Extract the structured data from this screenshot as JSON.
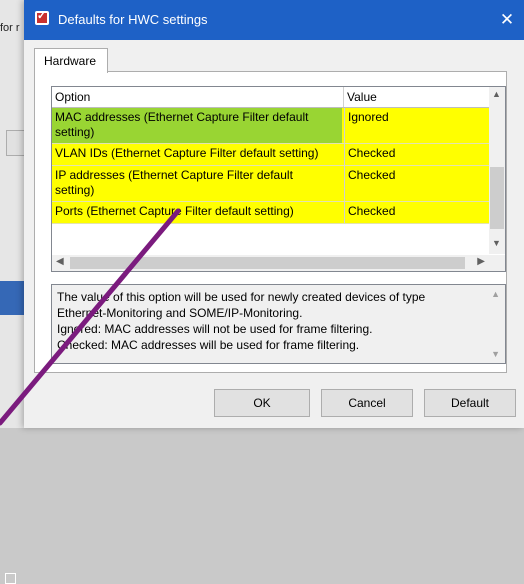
{
  "background": {
    "partial_text": "for r"
  },
  "dialog": {
    "title": "Defaults for HWC settings",
    "close_glyph": "✕",
    "tab_label": "Hardware",
    "columns": {
      "option": "Option",
      "value": "Value"
    },
    "rows": [
      {
        "option_lines": [
          "MAC addresses (Ethernet Capture Filter default",
          "setting)"
        ],
        "value": "Ignored",
        "selected": true
      },
      {
        "option_lines": [
          "VLAN IDs (Ethernet Capture Filter default setting)"
        ],
        "value": "Checked",
        "selected": false
      },
      {
        "option_lines": [
          "IP addresses (Ethernet Capture Filter default",
          "setting)"
        ],
        "value": "Checked",
        "selected": false
      },
      {
        "option_lines": [
          "Ports (Ethernet Capture Filter default setting)"
        ],
        "value": "Checked",
        "selected": false
      }
    ],
    "description_lines": [
      "The value of this option will be used for newly created devices of type",
      "Ethernet-Monitoring and SOME/IP-Monitoring.",
      "Ignored: MAC addresses will not be used for frame filtering.",
      "Checked: MAC addresses will be used for frame filtering."
    ],
    "buttons": {
      "ok": "OK",
      "cancel": "Cancel",
      "default": "Default"
    }
  },
  "colors": {
    "row_highlight": "#ffff00",
    "selected_cell": "#99d533",
    "title_bar": "#1e61c6",
    "annotation_line": "#7b1b7e"
  },
  "icons": [
    "app-icon",
    "close-icon",
    "scroll-up-icon",
    "scroll-down-icon",
    "scroll-left-icon",
    "scroll-right-icon"
  ]
}
